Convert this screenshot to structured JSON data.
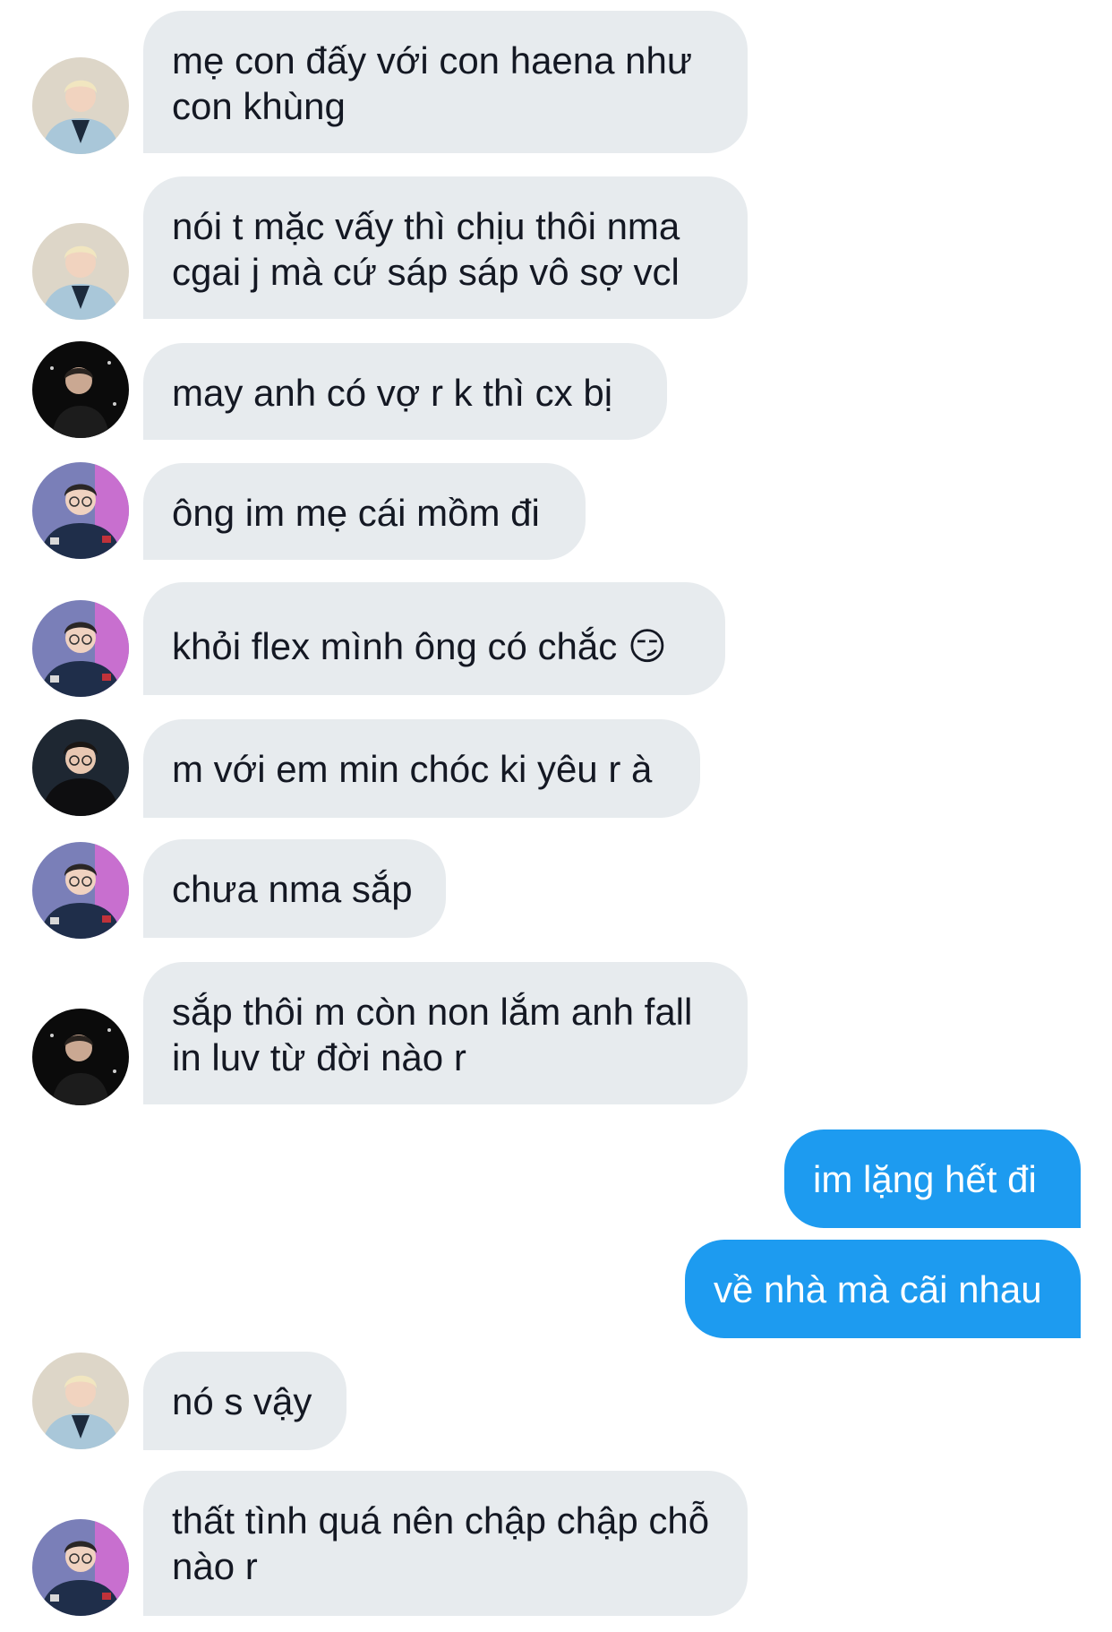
{
  "messages": [
    {
      "direction": "in",
      "sender_avatar": "avatar-blonde-light-jersey",
      "text": "mẹ con đấy với con haena như con khùng"
    },
    {
      "direction": "in",
      "sender_avatar": "avatar-blonde-light-jersey",
      "text": "nói t mặc vấy thì chịu thôi nma cgai j mà cứ sáp sáp vô sợ vcl"
    },
    {
      "direction": "in",
      "sender_avatar": "avatar-dark-background",
      "text": "may anh có vợ r k thì cx bị"
    },
    {
      "direction": "in",
      "sender_avatar": "avatar-glasses-team-jacket",
      "text": "ông im mẹ cái mồm đi"
    },
    {
      "direction": "in",
      "sender_avatar": "avatar-glasses-team-jacket",
      "text": "khỏi flex mình ông có chắc 😏"
    },
    {
      "direction": "in",
      "sender_avatar": "avatar-black-hoodie",
      "text": "m với em min chóc ki yêu r à"
    },
    {
      "direction": "in",
      "sender_avatar": "avatar-glasses-team-jacket",
      "text": "chưa nma sắp"
    },
    {
      "direction": "in",
      "sender_avatar": "avatar-dark-background",
      "text": "sắp thôi m còn non lắm anh fall in luv từ đời nào r"
    },
    {
      "direction": "out",
      "text": "im lặng hết đi"
    },
    {
      "direction": "out",
      "text": "về nhà mà cãi nhau"
    },
    {
      "direction": "in",
      "sender_avatar": "avatar-blonde-light-jersey",
      "text": "nó s vậy"
    },
    {
      "direction": "in",
      "sender_avatar": "avatar-glasses-team-jacket",
      "text": "thất tình quá nên chập chập chỗ nào r"
    }
  ],
  "colors": {
    "incoming_bubble": "#e7ebee",
    "outgoing_bubble": "#1d9bf0",
    "incoming_text": "#141823",
    "outgoing_text": "#ffffff"
  }
}
